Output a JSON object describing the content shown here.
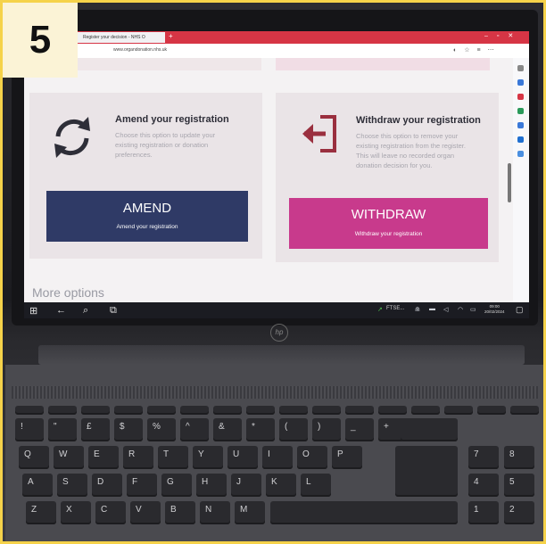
{
  "step": "5",
  "browser": {
    "tab_title": "Register your decision - NHS O",
    "url": "www.organdonation.nhs.uk"
  },
  "amend_card": {
    "title": "Amend your registration",
    "description_lines": [
      "Choose this option to update your",
      "existing registration or donation",
      "preferences."
    ],
    "button_label": "AMEND",
    "button_sub": "Amend your registration"
  },
  "withdraw_card": {
    "title": "Withdraw your registration",
    "description_lines": [
      "Choose this option to remove your",
      "existing registration from the register.",
      "This will leave no recorded organ",
      "donation decision for you."
    ],
    "button_label": "WITHDRAW",
    "button_sub": "Withdraw your registration"
  },
  "more_options": "More options",
  "taskbar": {
    "tray_text": "FTSE...",
    "time": "09:00",
    "date": "20/02/2024"
  },
  "colors": {
    "amend_button": "#2f3a66",
    "withdraw_button": "#c83a8c",
    "withdraw_icon": "#9a2f3f",
    "titlebar": "#d63545"
  },
  "keyboard": {
    "row_numbers": [
      "!",
      "\"",
      "£",
      "$",
      "%",
      "^",
      "&",
      "*",
      "(",
      ")",
      "_",
      "+"
    ],
    "row_q": [
      "Q",
      "W",
      "E",
      "R",
      "T",
      "Y",
      "U",
      "I",
      "O",
      "P"
    ],
    "row_a": [
      "A",
      "S",
      "D",
      "F",
      "G",
      "H",
      "J",
      "K",
      "L"
    ],
    "row_z": [
      "Z",
      "X",
      "C",
      "V",
      "B",
      "N",
      "M"
    ],
    "numpad": [
      "7",
      "8",
      "4",
      "5",
      "1",
      "2"
    ]
  }
}
